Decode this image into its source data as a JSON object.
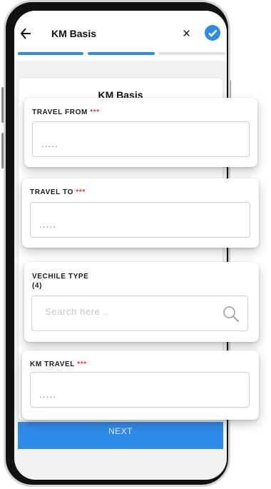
{
  "header": {
    "title": "KM Basis",
    "close_glyph": "×"
  },
  "steps": {
    "total": 3,
    "completed": 2,
    "active_color": "#2f8be8",
    "inactive_color": "#e2e2e2"
  },
  "form": {
    "title": "KM Basis",
    "fields": [
      {
        "label": "TRAVEL FROM",
        "required_mark": "***",
        "value_placeholder": "....."
      },
      {
        "label": "TRAVEL TO",
        "required_mark": "***",
        "value_placeholder": "....."
      },
      {
        "label": "VECHILE TYPE",
        "count": "(4)",
        "search_placeholder": "Search here ..",
        "icon": "search-icon"
      },
      {
        "label": "KM TRAVEL",
        "required_mark": "***",
        "value_placeholder": "....."
      }
    ],
    "next_label": "NEXT"
  },
  "colors": {
    "accent": "#2f8be8",
    "required": "#e53935"
  }
}
